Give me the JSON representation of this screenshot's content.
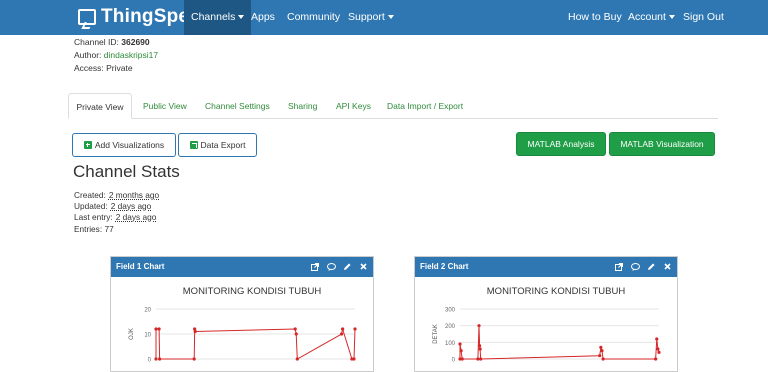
{
  "navbar": {
    "brand": "ThingSpeak",
    "brand_tm": "™",
    "left_items": [
      {
        "label": "Channels",
        "caret": true,
        "active": true
      },
      {
        "label": "Apps",
        "caret": false
      },
      {
        "label": "Community",
        "caret": false
      },
      {
        "label": "Support",
        "caret": true
      }
    ],
    "right_items": [
      {
        "label": "How to Buy",
        "caret": false
      },
      {
        "label": "Account",
        "caret": true
      },
      {
        "label": "Sign Out",
        "caret": false
      }
    ]
  },
  "channel": {
    "id_label": "Channel ID:",
    "id_value": "362690",
    "author_label": "Author:",
    "author_value": "dindaskripsi17",
    "access_label": "Access:",
    "access_value": "Private"
  },
  "tabs": [
    "Private View",
    "Public View",
    "Channel Settings",
    "Sharing",
    "API Keys",
    "Data Import / Export"
  ],
  "buttons": {
    "add_visualizations": "Add Visualizations",
    "data_export": "Data Export",
    "matlab_analysis": "MATLAB Analysis",
    "matlab_visualization": "MATLAB Visualization"
  },
  "stats": {
    "title": "Channel Stats",
    "created_label": "Created:",
    "created_value": "2 months ago",
    "updated_label": "Updated:",
    "updated_value": "2 days ago",
    "last_entry_label": "Last entry:",
    "last_entry_value": "2 days ago",
    "entries_label": "Entries:",
    "entries_value": "77"
  },
  "colors": {
    "navbar": "#2f77b2",
    "navbar_active": "#1e5784",
    "link_green": "#2f8c3a",
    "button_green": "#1f9d47",
    "series_red": "#d62728"
  },
  "panels": [
    {
      "title": "Field 1 Chart",
      "icons": [
        "external-link-icon",
        "comment-icon",
        "pencil-icon",
        "close-icon"
      ]
    },
    {
      "title": "Field 2 Chart",
      "icons": [
        "external-link-icon",
        "comment-icon",
        "pencil-icon",
        "close-icon"
      ]
    }
  ],
  "chart_data": [
    {
      "type": "line",
      "title": "MONITORING KONDISI TUBUH",
      "ylabel": "OJK",
      "xlabel": "",
      "ylim": [
        0,
        20
      ],
      "yticks": [
        0,
        10,
        20
      ],
      "grid": true,
      "series": [
        {
          "values": [
            [
              0,
              0
            ],
            [
              0,
              12
            ],
            [
              0.3,
              12
            ],
            [
              0.35,
              0
            ],
            [
              3.7,
              0
            ],
            [
              3.75,
              12
            ],
            [
              3.8,
              11
            ],
            [
              13.5,
              12
            ],
            [
              13.6,
              10
            ],
            [
              13.7,
              0
            ],
            [
              18,
              10
            ],
            [
              18.1,
              12
            ],
            [
              19,
              0
            ],
            [
              19.2,
              0
            ],
            [
              19.3,
              12
            ]
          ]
        }
      ]
    },
    {
      "type": "line",
      "title": "MONITORING KONDISI TUBUH",
      "ylabel": "DETAK",
      "xlabel": "",
      "ylim": [
        0,
        300
      ],
      "yticks": [
        0,
        100,
        200,
        300
      ],
      "grid": true,
      "series": [
        {
          "values": [
            [
              0,
              0
            ],
            [
              0,
              90
            ],
            [
              0.1,
              50
            ],
            [
              0.2,
              0
            ],
            [
              1.6,
              0
            ],
            [
              1.7,
              200
            ],
            [
              1.75,
              80
            ],
            [
              1.8,
              60
            ],
            [
              1.85,
              0
            ],
            [
              12.5,
              20
            ],
            [
              12.6,
              70
            ],
            [
              12.7,
              50
            ],
            [
              12.8,
              0
            ],
            [
              17.5,
              0
            ],
            [
              17.6,
              120
            ],
            [
              17.7,
              60
            ],
            [
              17.8,
              40
            ]
          ]
        }
      ]
    }
  ]
}
